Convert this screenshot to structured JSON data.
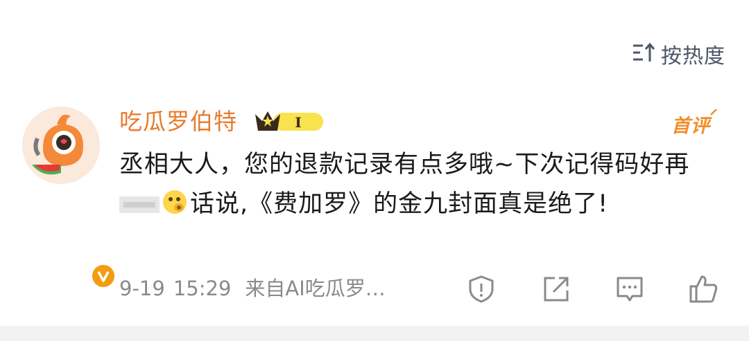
{
  "sort": {
    "label": "按热度",
    "icon": "sort-icon"
  },
  "comment": {
    "username": "吃瓜罗伯特",
    "rank_badge_text": "I",
    "tag": "首评",
    "text_part1": "丞相大人，您的退款记录有点多哦~下次记得码好再",
    "text_part2": "话说,《费加罗》的金九封面真是绝了!",
    "date": "9-19",
    "time": "15:29",
    "source": "来自AI吃瓜罗…",
    "accent_color": "#ea7a2c"
  },
  "actions": {
    "icons": [
      "report-icon",
      "share-icon",
      "reply-icon",
      "like-icon"
    ]
  }
}
